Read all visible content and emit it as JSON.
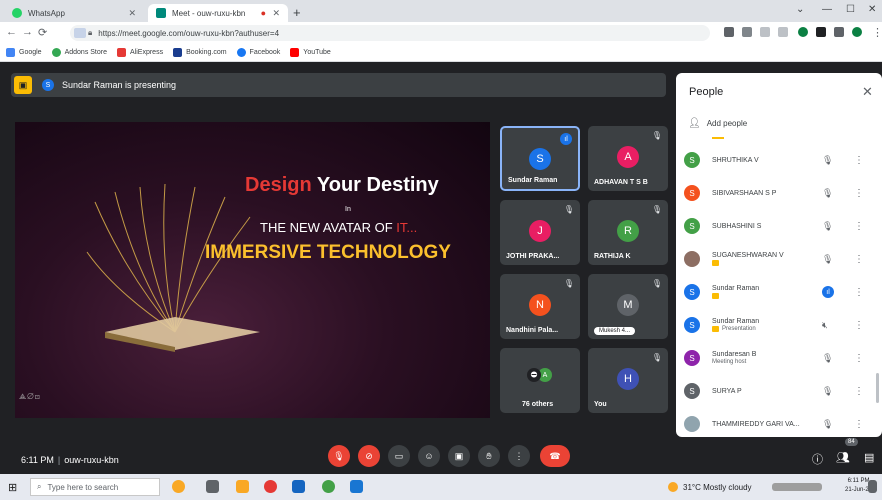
{
  "browser": {
    "tabs": [
      {
        "label": "WhatsApp",
        "color": "#25d366"
      },
      {
        "label": "Meet - ouw-ruxu-kbn",
        "color": "#00897b"
      }
    ],
    "url": "https://meet.google.com/ouw-ruxu-kbn?authuser=4",
    "bookmarks": [
      {
        "label": "Google",
        "color": "#4285f4"
      },
      {
        "label": "Addons Store",
        "color": "#34a853"
      },
      {
        "label": "AliExpress",
        "color": "#e53935"
      },
      {
        "label": "Booking.com",
        "color": "#1a3d8f"
      },
      {
        "label": "Facebook",
        "color": "#1877f2"
      },
      {
        "label": "YouTube",
        "color": "#ff0000"
      }
    ]
  },
  "meet": {
    "presenting_label": "Sundar Raman is presenting",
    "presenter_initial": "S",
    "slide": {
      "title_red": "Design",
      "title_white": "Your Destiny",
      "in": "In",
      "subtitle_white": "THE NEW AVATAR OF",
      "subtitle_red": "IT...",
      "tagline": "IMMERSIVE TECHNOLOGY"
    },
    "tiles": [
      {
        "initial": "S",
        "name": "Sundar Raman",
        "color": "#1a73e8",
        "speaking": true
      },
      {
        "initial": "A",
        "name": "ADHAVAN T S B",
        "color": "#e91e63"
      },
      {
        "initial": "J",
        "name": "JOTHI PRAKA...",
        "color": "#e91e63"
      },
      {
        "initial": "R",
        "name": "RATHIJA K",
        "color": "#43a047"
      },
      {
        "initial": "N",
        "name": "Nandhini Pala...",
        "color": "#f4511e"
      },
      {
        "initial": "M",
        "name": "Mukesh 4...",
        "color": "#5f6368"
      },
      {
        "initial": "A",
        "name": "76 others",
        "color": "#43a047"
      },
      {
        "initial": "H",
        "name": "You",
        "color": "#3f51b5"
      }
    ],
    "meeting_time": "6:11 PM",
    "meeting_code": "ouw-ruxu-kbn",
    "participant_count": "84"
  },
  "people": {
    "title": "People",
    "add_label": "Add people",
    "rows": [
      {
        "initial": "S",
        "name": "SHRUTHIKA V",
        "sub": "",
        "color": "#43a047"
      },
      {
        "initial": "S",
        "name": "SIBIVARSHAAN S P",
        "sub": "",
        "color": "#f4511e"
      },
      {
        "initial": "S",
        "name": "SUBHASHINI S",
        "sub": "",
        "color": "#43a047"
      },
      {
        "initial": "",
        "name": "SUGANESHWARAN V",
        "sub": "",
        "color": "#8d6e63",
        "badge": true
      },
      {
        "initial": "S",
        "name": "Sundar Raman",
        "sub": "",
        "color": "#1a73e8",
        "badge": true,
        "speaking": true
      },
      {
        "initial": "S",
        "name": "Sundar Raman",
        "sub": "Presentation",
        "color": "#1a73e8",
        "badge": true
      },
      {
        "initial": "S",
        "name": "Sundaresan B",
        "sub": "Meeting host",
        "color": "#8e24aa"
      },
      {
        "initial": "S",
        "name": "SURYA P",
        "sub": "",
        "color": "#5f6368"
      },
      {
        "initial": "",
        "name": "THAMMIREDDY GARI VA...",
        "sub": "",
        "color": "#90a4ae"
      }
    ]
  },
  "taskbar": {
    "search_placeholder": "Type here to search",
    "weather": "31°C Mostly cloudy",
    "time": "6:11 PM",
    "date": "21-Jun-23"
  }
}
